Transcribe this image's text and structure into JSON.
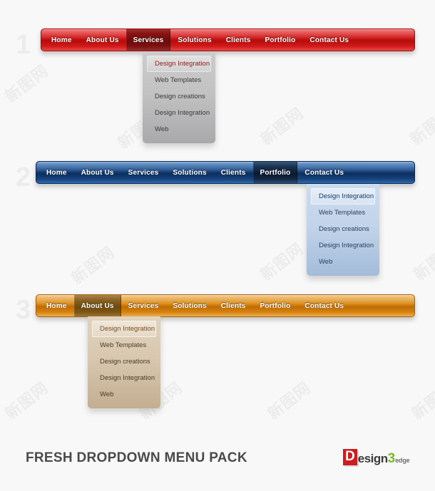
{
  "page": {
    "background": "#f8f8f8",
    "watermark_text": "新图网",
    "footer_title": "FRESH DROPDOWN MENU PACK"
  },
  "logo": {
    "d": "D",
    "esign": "esign",
    "three": "3",
    "edge": "edge"
  },
  "menus": [
    {
      "index_label": "1",
      "theme": "red",
      "accent": "#cf1414",
      "active_item": "Services",
      "items": [
        {
          "label": "Home"
        },
        {
          "label": "About Us"
        },
        {
          "label": "Services"
        },
        {
          "label": "Solutions"
        },
        {
          "label": "Clients"
        },
        {
          "label": "Portfolio"
        },
        {
          "label": "Contact Us"
        }
      ],
      "dropdown": [
        {
          "label": "Design Integration",
          "highlighted": true
        },
        {
          "label": "Web Templates",
          "highlighted": false
        },
        {
          "label": "Design creations",
          "highlighted": false
        },
        {
          "label": "Design Integration",
          "highlighted": false
        },
        {
          "label": "Web",
          "highlighted": false
        }
      ]
    },
    {
      "index_label": "2",
      "theme": "blue",
      "accent": "#1b4d8c",
      "active_item": "Portfolio",
      "items": [
        {
          "label": "Home"
        },
        {
          "label": "About Us"
        },
        {
          "label": "Services"
        },
        {
          "label": "Solutions"
        },
        {
          "label": "Clients"
        },
        {
          "label": "Portfolio"
        },
        {
          "label": "Contact Us"
        }
      ],
      "dropdown": [
        {
          "label": "Design Integration",
          "highlighted": true
        },
        {
          "label": "Web Templates",
          "highlighted": false
        },
        {
          "label": "Design creations",
          "highlighted": false
        },
        {
          "label": "Design Integration",
          "highlighted": false
        },
        {
          "label": "Web",
          "highlighted": false
        }
      ]
    },
    {
      "index_label": "3",
      "theme": "orange",
      "accent": "#dd8c14",
      "active_item": "About Us",
      "items": [
        {
          "label": "Home"
        },
        {
          "label": "About Us"
        },
        {
          "label": "Services"
        },
        {
          "label": "Solutions"
        },
        {
          "label": "Clients"
        },
        {
          "label": "Portfolio"
        },
        {
          "label": "Contact Us"
        }
      ],
      "dropdown": [
        {
          "label": "Design Integration",
          "highlighted": true
        },
        {
          "label": "Web Templates",
          "highlighted": false
        },
        {
          "label": "Design creations",
          "highlighted": false
        },
        {
          "label": "Design Integration",
          "highlighted": false
        },
        {
          "label": "Web",
          "highlighted": false
        }
      ]
    }
  ]
}
